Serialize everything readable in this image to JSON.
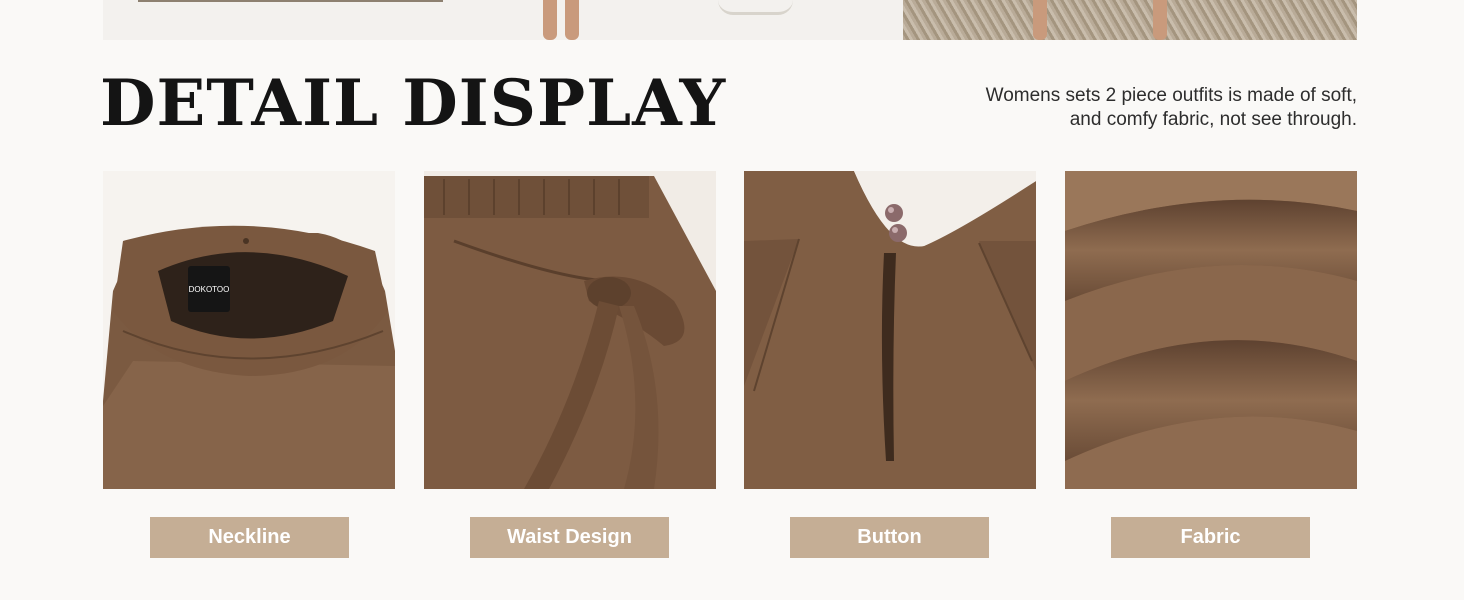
{
  "section": {
    "title": "DETAIL DISPLAY",
    "description_lines": [
      "Womens sets 2 piece outfits is made of soft,",
      "and comfy fabric, not see through."
    ]
  },
  "details": [
    {
      "label": "Neckline",
      "tag_text": "DOKOTOO"
    },
    {
      "label": "Waist Design"
    },
    {
      "label": "Button"
    },
    {
      "label": "Fabric"
    }
  ],
  "colors": {
    "background": "#faf9f7",
    "fabric_brown": "#7f5d43",
    "label_bg": "#c5ae95",
    "label_text": "#ffffff",
    "title_text": "#141414"
  }
}
